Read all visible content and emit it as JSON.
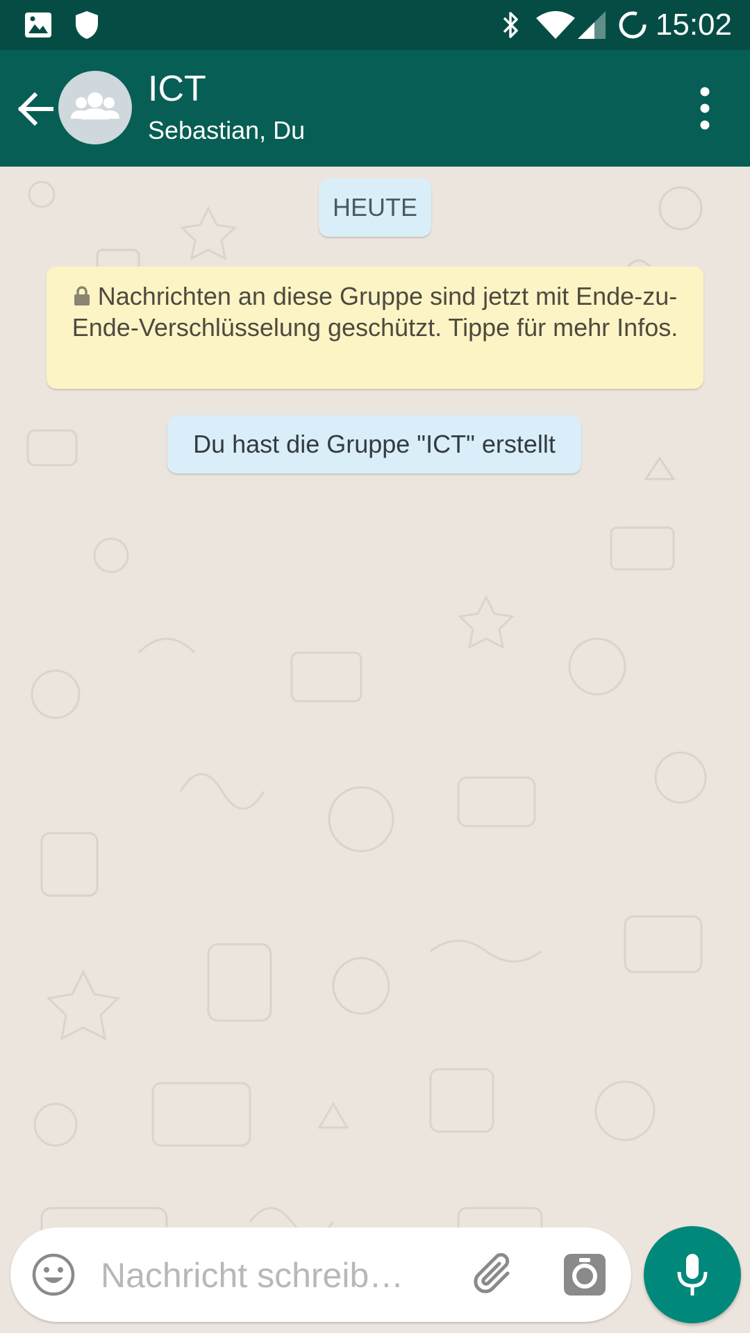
{
  "status_bar": {
    "time": "15:02",
    "icons": [
      "gallery-icon",
      "shield-icon",
      "bluetooth-icon",
      "wifi-icon",
      "cell-signal-icon",
      "sync-icon"
    ]
  },
  "app_bar": {
    "title": "ICT",
    "subtitle": "Sebastian, Du",
    "back_icon": "arrow-left-icon",
    "avatar_icon": "group-icon",
    "menu_icon": "more-vert-icon",
    "background": "#075e54"
  },
  "chat": {
    "date_label": "HEUTE",
    "encryption_notice": "Nachrichten an diese Gruppe sind jetzt mit Ende-zu-Ende-Verschlüsselung geschützt. Tippe für mehr Infos.",
    "system_message": "Du hast die Gruppe \"ICT\" erstellt"
  },
  "composer": {
    "placeholder": "Nachricht schreib…",
    "value": "",
    "emoji_icon": "emoji-icon",
    "attach_icon": "paperclip-icon",
    "camera_icon": "camera-icon",
    "mic_icon": "microphone-icon",
    "accent": "#00897b"
  }
}
